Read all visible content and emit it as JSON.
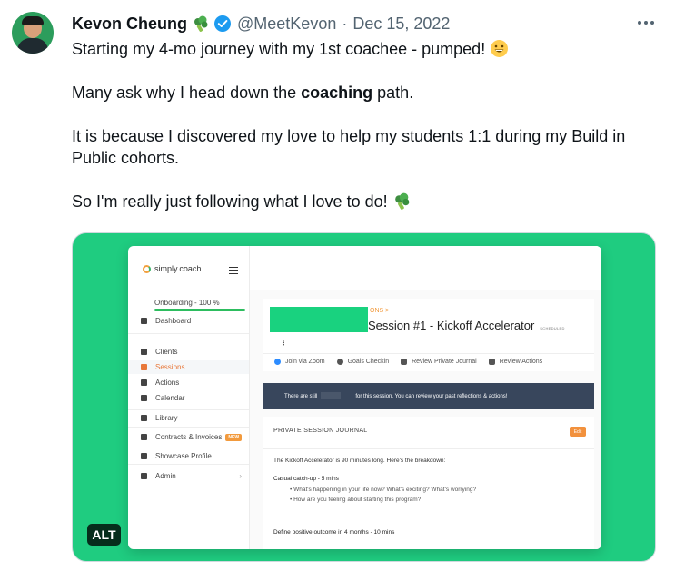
{
  "author": {
    "name": "Kevon Cheung",
    "handle": "@MeetKevon",
    "separator": "·",
    "date": "Dec 15, 2022"
  },
  "tweet": {
    "line1": "Starting my 4-mo journey with my 1st coachee - pumped!",
    "line2_before": "Many ask why I head down the ",
    "line2_bold": "coaching",
    "line2_after": " path.",
    "line3": "It is because I discovered my love to help my students 1:1 during my Build in Public cohorts.",
    "line4": "So I'm really just following what I love to do!"
  },
  "media": {
    "alt_badge": "ALT",
    "app": {
      "logo": "simply.coach",
      "onboarding": "Onboarding - 100 %",
      "onboarding_progress": 1.0,
      "nav": [
        {
          "label": "Dashboard"
        },
        {
          "label": "Clients"
        },
        {
          "label": "Sessions"
        },
        {
          "label": "Actions"
        },
        {
          "label": "Calendar"
        },
        {
          "label": "Library"
        },
        {
          "label": "Contracts & Invoices",
          "badge": "NEW"
        },
        {
          "label": "Showcase Profile"
        },
        {
          "label": "Admin"
        }
      ],
      "breadcrumb": "ONS >",
      "session_title": "Session #1 - Kickoff Accelerator",
      "session_status": "SCHEDULED",
      "actions": [
        {
          "label": "Join via Zoom"
        },
        {
          "label": "Goals Checkin"
        },
        {
          "label": "Review Private Journal"
        },
        {
          "label": "Review Actions"
        }
      ],
      "banner_pre": "There are still",
      "banner_post": "for this session. You can review your past reflections & actions!",
      "journal_title": "PRIVATE SESSION JOURNAL",
      "journal_edit": "Edit",
      "journal_intro": "The Kickoff Accelerator is 90 minutes long. Here's the breakdown:",
      "section1": "Casual catch-up - 5 mins",
      "bullet1": "What's happening in your life now? What's exciting? What's worrying?",
      "bullet2": "How are you feeling about starting this program?",
      "section2": "Define positive outcome in 4 months - 10 mins"
    }
  }
}
